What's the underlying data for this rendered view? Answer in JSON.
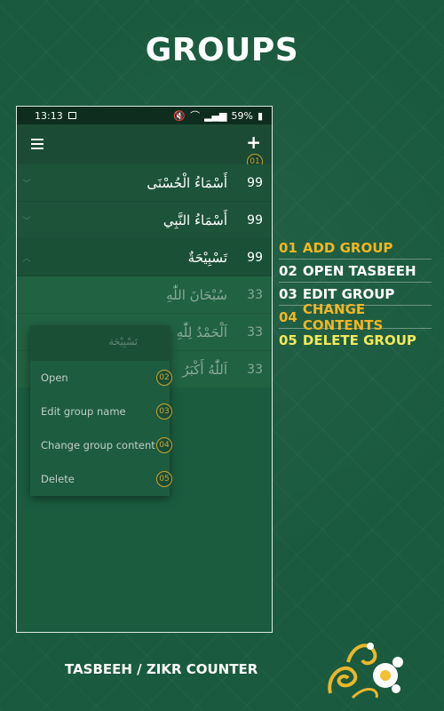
{
  "title": "GROUPS",
  "status": {
    "time": "13:13",
    "battery": "59%"
  },
  "groups": [
    {
      "label": "أَسْمَاءُ الْحُسْنَى",
      "count": "99",
      "expanded": false
    },
    {
      "label": "أَسْمَاءُ النَّبِي",
      "count": "99",
      "expanded": false
    },
    {
      "label": "تَسْبِيْحَةٌ",
      "count": "99",
      "expanded": true
    }
  ],
  "items": [
    {
      "label": "سُبْحَانَ اللّٰهِ",
      "count": "33"
    },
    {
      "label": "اَلْحَمْدُ لِلّٰهِ",
      "count": "33"
    },
    {
      "label": "اَللّٰهُ أَكْبَرُ",
      "count": "33"
    }
  ],
  "popup": {
    "header": "تَسْبِيْحَة",
    "items": [
      {
        "label": "Open",
        "badge": "02"
      },
      {
        "label": "Edit group name",
        "badge": "03"
      },
      {
        "label": "Change group content",
        "badge": "04"
      },
      {
        "label": "Delete",
        "badge": "05"
      }
    ]
  },
  "add_badge": "01",
  "legend": [
    {
      "num": "01",
      "label": "ADD GROUP",
      "color": "#f2b622"
    },
    {
      "num": "02",
      "label": "OPEN TASBEEH",
      "color": "#ffffff"
    },
    {
      "num": "03",
      "label": "EDIT GROUP",
      "color": "#ffffff"
    },
    {
      "num": "04",
      "label": "CHANGE CONTENTS",
      "color": "#f2b622"
    },
    {
      "num": "05",
      "label": "DELETE GROUP",
      "color": "#f2e85a"
    }
  ],
  "footer": "TASBEEH / ZIKR COUNTER"
}
